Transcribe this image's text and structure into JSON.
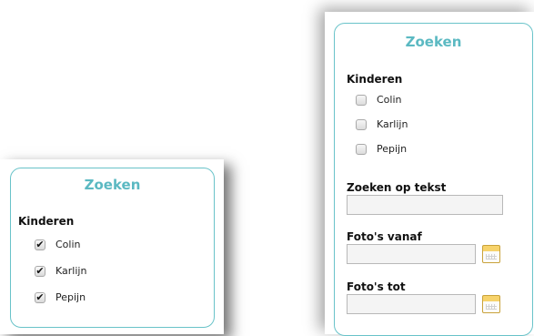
{
  "left_panel": {
    "title": "Zoeken",
    "kinderen_label": "Kinderen",
    "children": [
      {
        "name": "Colin",
        "checked": true
      },
      {
        "name": "Karlijn",
        "checked": true
      },
      {
        "name": "Pepijn",
        "checked": true
      }
    ]
  },
  "right_panel": {
    "title": "Zoeken",
    "kinderen_label": "Kinderen",
    "children": [
      {
        "name": "Colin",
        "checked": false
      },
      {
        "name": "Karlijn",
        "checked": false
      },
      {
        "name": "Pepijn",
        "checked": false
      }
    ],
    "search_text_label": "Zoeken op tekst",
    "photos_from_label": "Foto's vanaf",
    "photos_to_label": "Foto's tot"
  },
  "colors": {
    "accent": "#5bb9c2",
    "border": "#69c3c9"
  }
}
